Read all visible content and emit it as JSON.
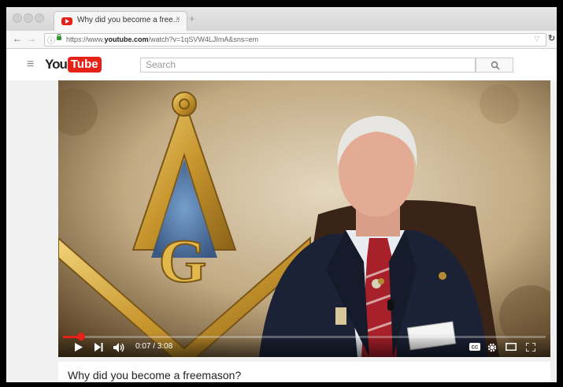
{
  "browser": {
    "tab_title": "Why did you become a free...",
    "tab_close": "×",
    "new_tab": "+",
    "url_prefix": "https://www.",
    "url_domain": "youtube.com",
    "url_path": "/watch?v=1qSVW4LJImA&sns=em",
    "icons": [
      "back-arrow-icon",
      "forward-arrow-icon",
      "info-icon",
      "lock-icon",
      "reload-icon",
      "bookmark-icon"
    ]
  },
  "youtube": {
    "logo_you": "You",
    "logo_tube": "Tube",
    "search_placeholder": "Search",
    "brand_color": "#e62117"
  },
  "player": {
    "current_time": "0:07",
    "duration": "3:08",
    "time_display": "0:07 / 3:08",
    "progress_fraction": 0.037
  },
  "video": {
    "title": "Why did you become a freemason?"
  }
}
